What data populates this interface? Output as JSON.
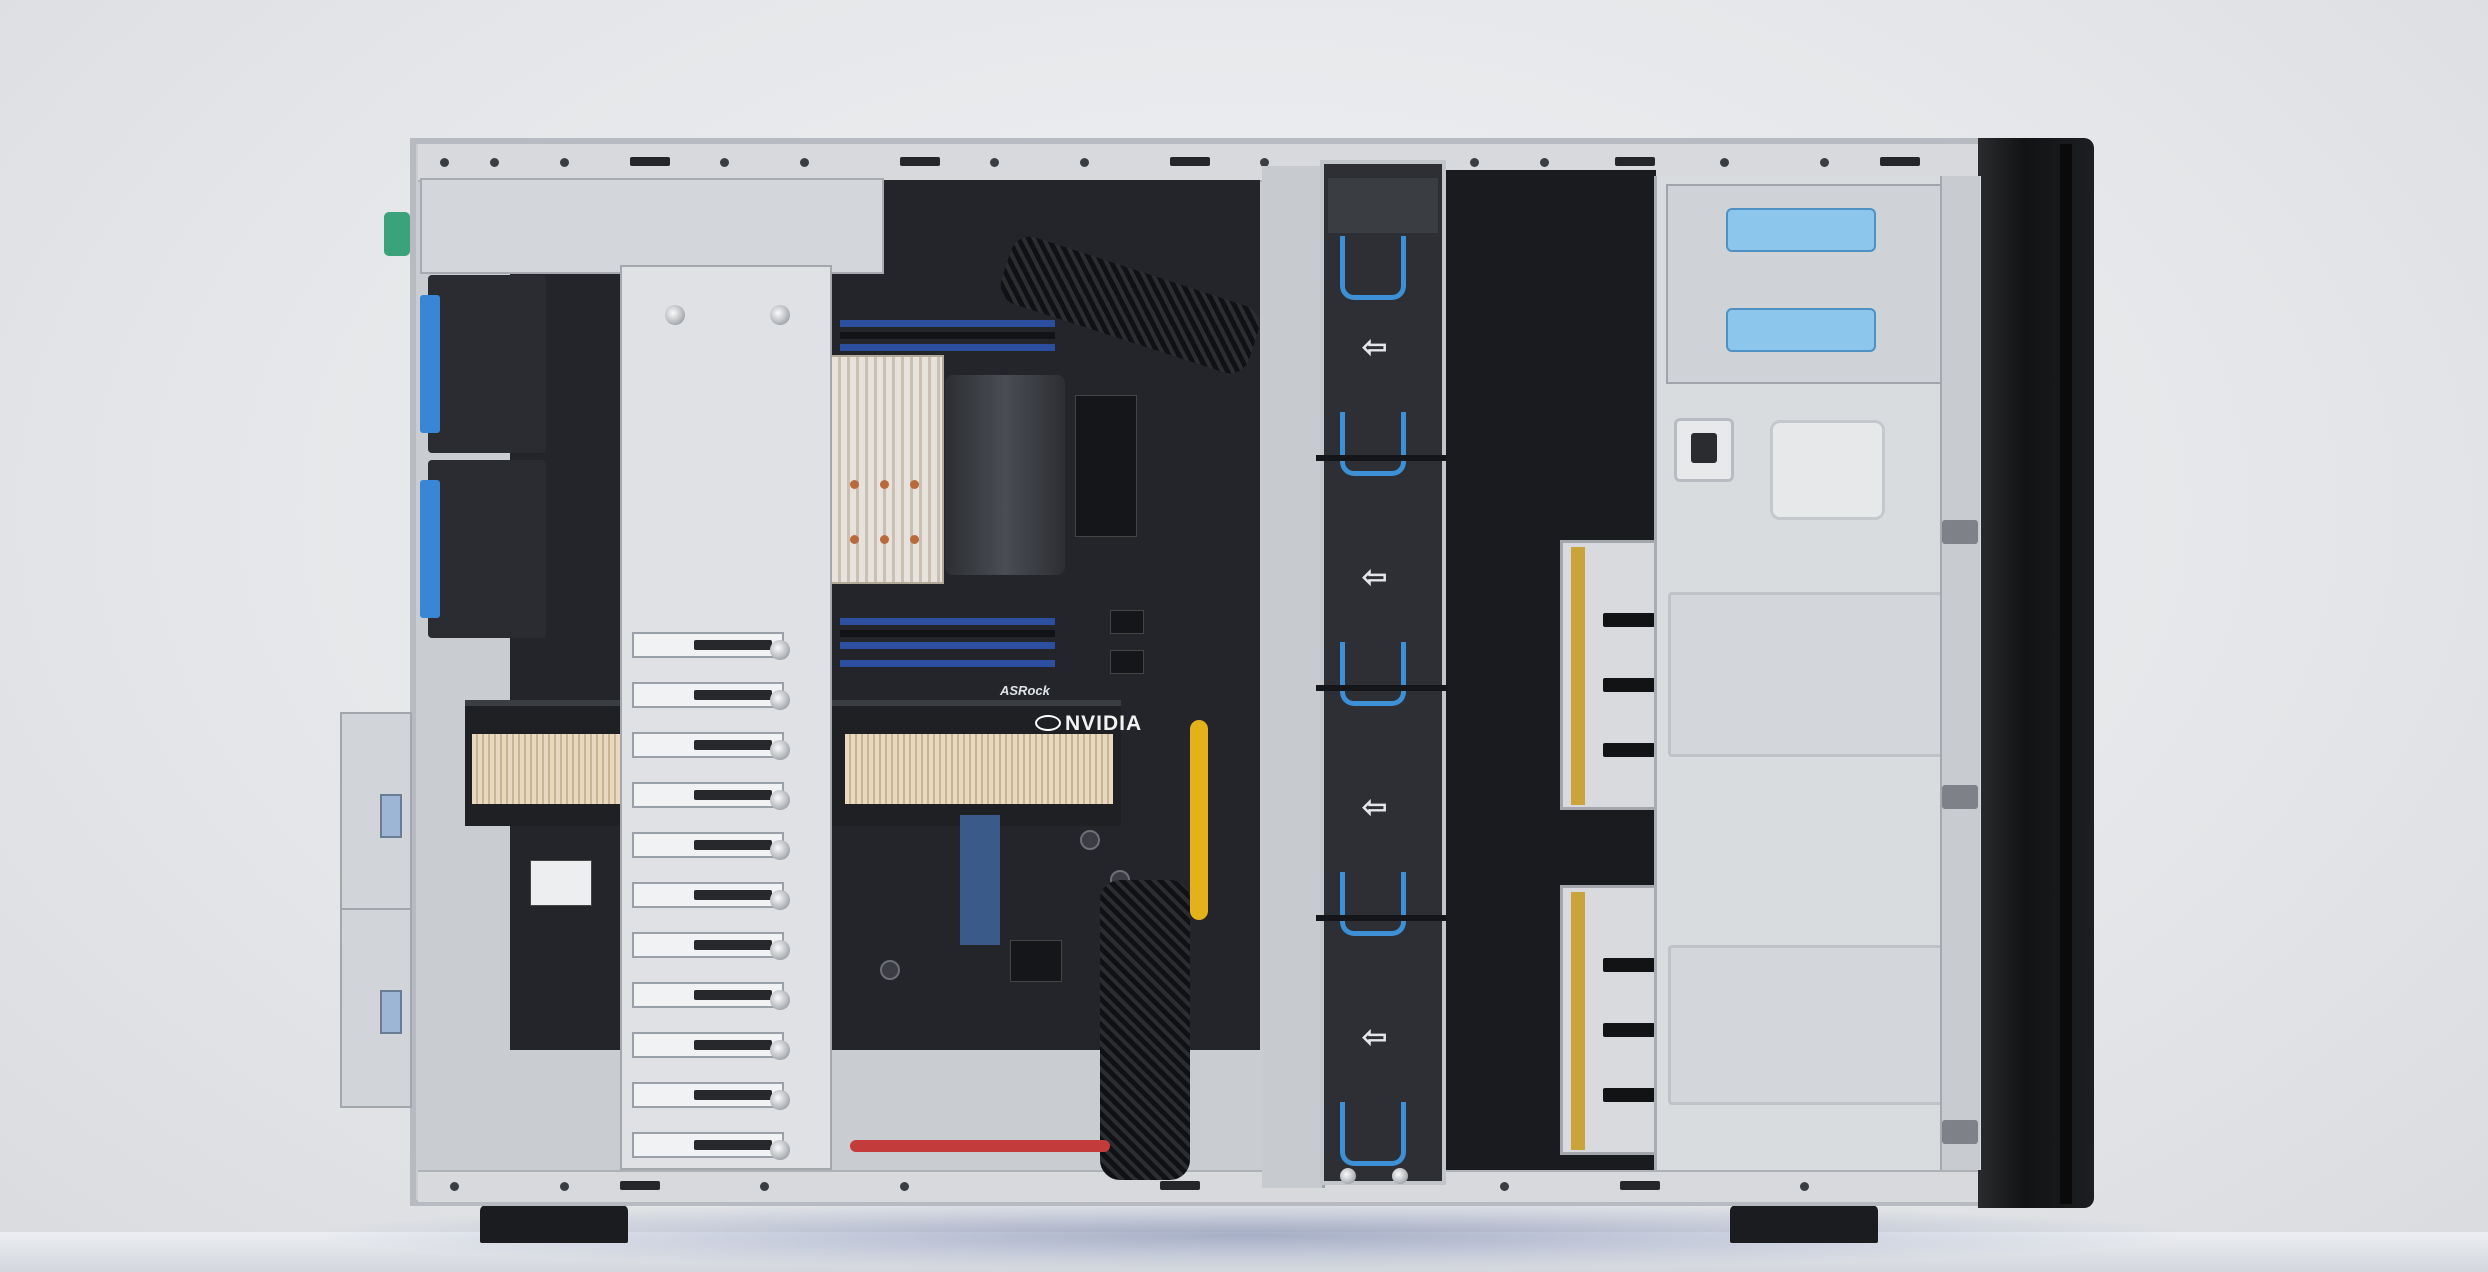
{
  "image": {
    "subject": "server-tower-chassis-open",
    "colors": {
      "background": "#e4e6e9",
      "chassis": "#c9ccd0",
      "bezel": "#121315",
      "accent_blue": "#3d8fd6",
      "latch_blue": "#8cc6ec"
    }
  },
  "labels": {
    "gpu_brand": "NVIDIA",
    "board_brand": "ASRock",
    "fan_arrows": [
      "⇦",
      "⇦",
      "⇦",
      "⇦"
    ]
  }
}
